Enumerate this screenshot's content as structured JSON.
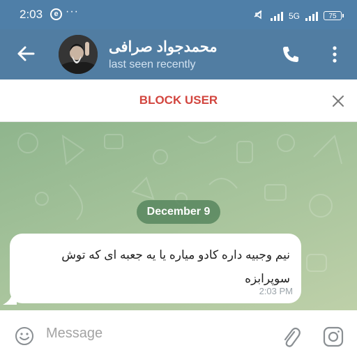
{
  "status_bar": {
    "time": "2:03",
    "app_icon_glyph": "e",
    "dots": "···",
    "network_label": "5G",
    "battery": "75"
  },
  "header": {
    "back_icon": "arrow-left-icon",
    "title": "محمدجواد صرافی",
    "subtitle": "last seen recently",
    "call_icon": "phone-icon",
    "menu_icon": "more-vertical-icon",
    "background_color": "#517da2"
  },
  "block_bar": {
    "label": "BLOCK USER",
    "label_color": "#d2453e",
    "close_icon": "close-icon"
  },
  "chat": {
    "date": "December 9",
    "messages": [
      {
        "text": "نیم وجبیه داره کادو میاره یا یه جعبه ای که توش سوپرابزه",
        "time": "2:03 PM",
        "direction": "incoming"
      }
    ],
    "background_color": "#a4c29a"
  },
  "input_bar": {
    "emoji_icon": "emoji-icon",
    "placeholder": "Message",
    "attach_icon": "paperclip-icon",
    "camera_icon": "camera-icon"
  }
}
